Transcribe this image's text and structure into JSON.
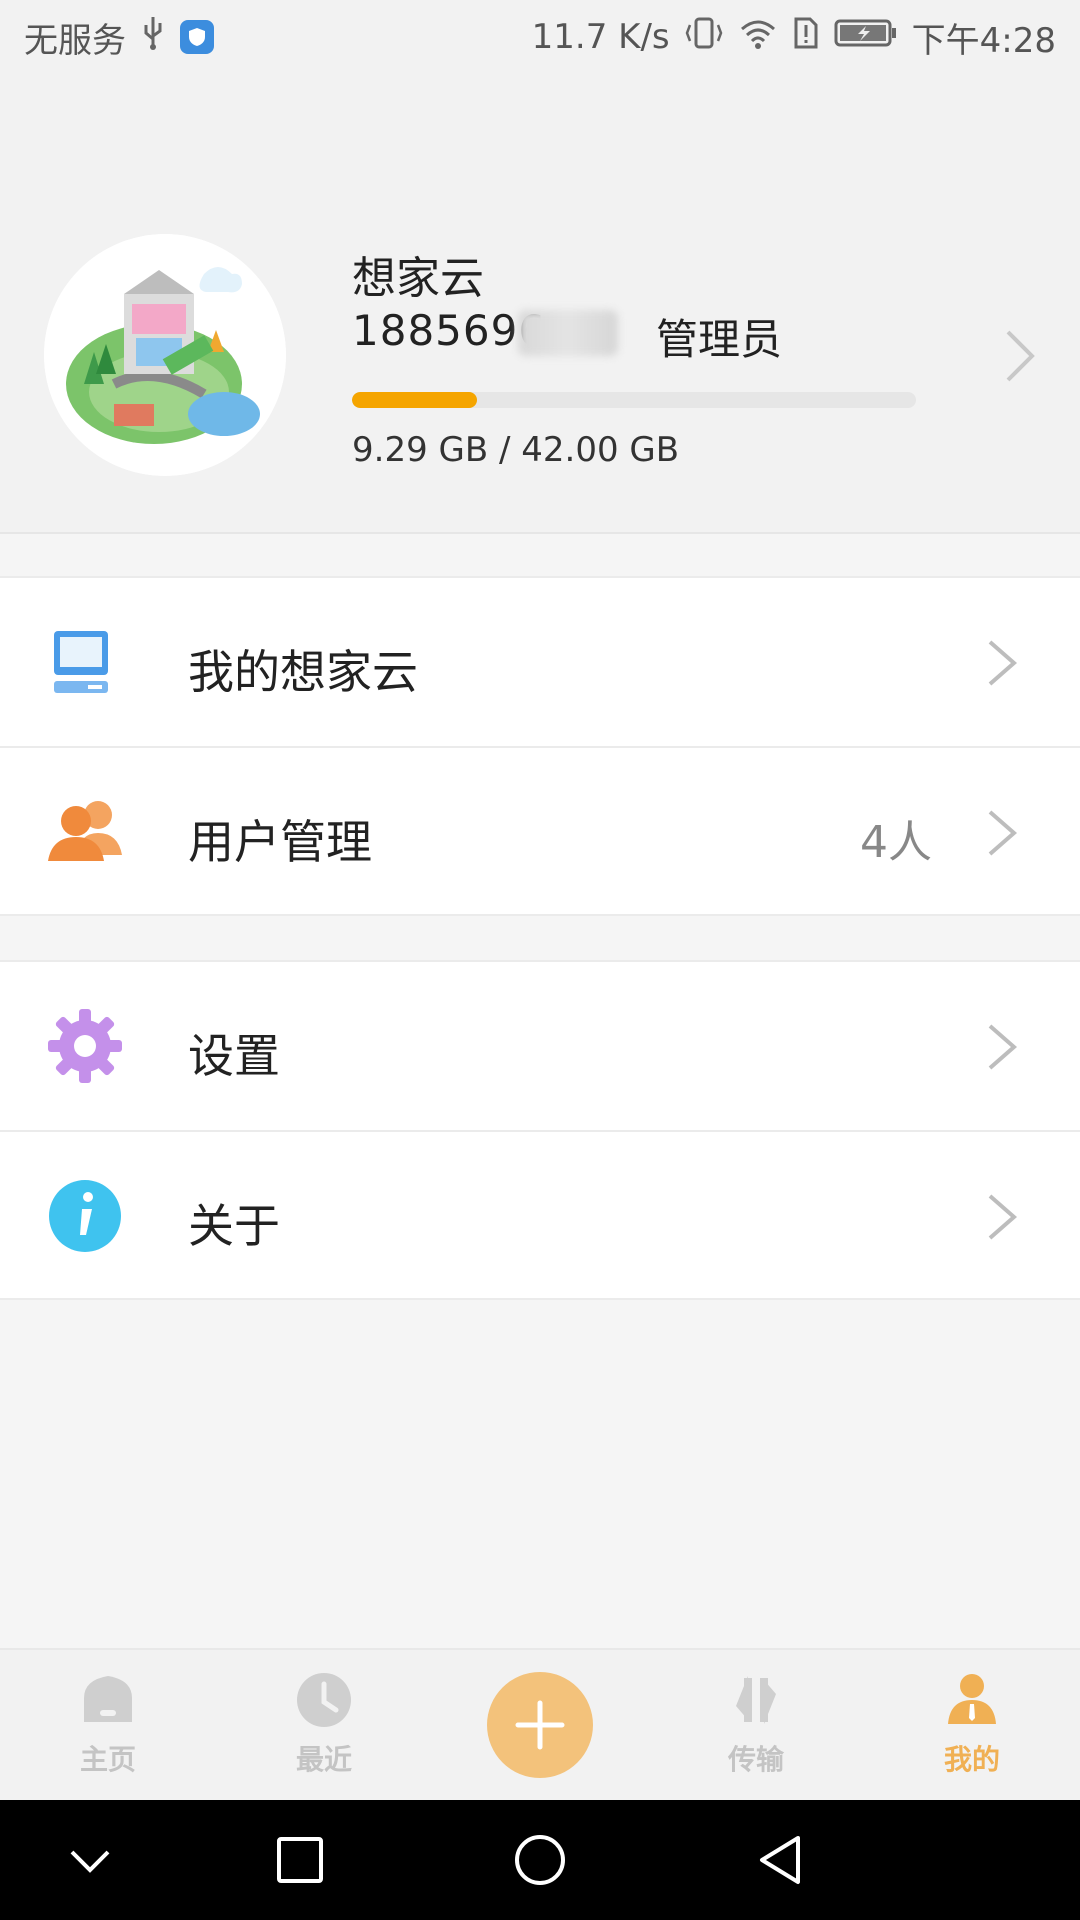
{
  "status_bar": {
    "carrier": "无服务",
    "speed": "11.7 K/s",
    "time": "下午4:28"
  },
  "profile": {
    "name": "想家云",
    "phone": "1885696",
    "role": "管理员",
    "quota_text": "9.29 GB / 42.00 GB",
    "quota_fraction": 0.221
  },
  "menu_group_1": [
    {
      "label": "我的想家云",
      "value": ""
    },
    {
      "label": "用户管理",
      "value": "4人"
    }
  ],
  "menu_group_2": [
    {
      "label": "设置",
      "value": ""
    },
    {
      "label": "关于",
      "value": ""
    }
  ],
  "tabs": [
    {
      "label": "主页",
      "icon": "home-icon",
      "active": false
    },
    {
      "label": "最近",
      "icon": "clock-icon",
      "active": false
    },
    {
      "label": "",
      "icon": "plus-icon",
      "active": false
    },
    {
      "label": "传输",
      "icon": "transfer-icon",
      "active": false
    },
    {
      "label": "我的",
      "icon": "user-icon",
      "active": true
    }
  ],
  "colors": {
    "accent": "#f5a500",
    "tab_active": "#f0b054",
    "fab": "#f3c27b"
  }
}
